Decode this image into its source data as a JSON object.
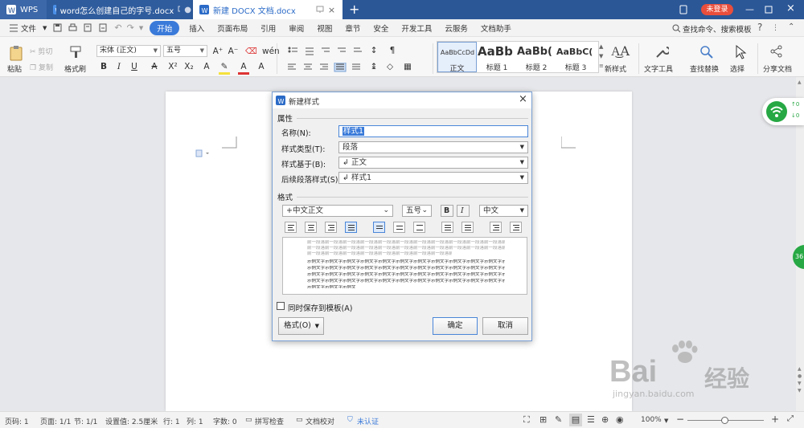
{
  "titlebar": {
    "app_label": "WPS",
    "tabs": [
      {
        "label": "word怎么创建自己的字号.docx"
      },
      {
        "label": "新建 DOCX 文档.docx"
      }
    ],
    "add_tab": "+",
    "login_label": "未登录"
  },
  "menubar": {
    "file_label": "文件",
    "items": [
      "开始",
      "插入",
      "页面布局",
      "引用",
      "审阅",
      "视图",
      "章节",
      "安全",
      "开发工具",
      "云服务",
      "文档助手"
    ],
    "search_label": "查找命令、搜索模板",
    "help": "?"
  },
  "ribbon": {
    "paste": "粘贴",
    "cut": "剪切",
    "copy": "复制",
    "format_painter": "格式刷",
    "font_name": "宋体 (正文)",
    "font_size": "五号",
    "bold": "B",
    "italic": "I",
    "underline": "U",
    "strike": "A",
    "superscript": "X²",
    "subscript": "X₂",
    "grow_font": "A⁺",
    "shrink_font": "A⁻",
    "styles": [
      {
        "preview": "AaBbCcDd",
        "name": "正文"
      },
      {
        "preview": "AaBb",
        "name": "标题 1"
      },
      {
        "preview": "AaBb(",
        "name": "标题 2"
      },
      {
        "preview": "AaBbC(",
        "name": "标题 3"
      }
    ],
    "new_style": "新样式",
    "text_tools": "文字工具",
    "find_replace": "查找替换",
    "select": "选择",
    "share": "分享文档"
  },
  "dialog": {
    "title": "新建样式",
    "props_section": "属性",
    "name_label": "名称(N):",
    "name_value": "样式1",
    "type_label": "样式类型(T):",
    "type_value": "段落",
    "based_label": "样式基于(B):",
    "based_value": "↲ 正文",
    "next_label": "后续段落样式(S):",
    "next_value": "↲ 样式1",
    "format_section": "格式",
    "font_value": "+中文正文",
    "size_value": "五号",
    "bold": "B",
    "italic": "I",
    "lang_value": "中文",
    "preview_prev_text": "前一段落前一段落前一段落前一段落前一段落前一段落前一段落前一段落前一段落前一段落前一段落前一段落前一段落前一段落",
    "preview_sample_text": "示例文字示例文字示例文字示例文字示例文字示例文字示例文字示例文字示例文字示例文字示例文字示例文字示例文字",
    "save_template_label": "同时保存到模板(A)",
    "format_button": "格式(O)",
    "ok_button": "确定",
    "cancel_button": "取消"
  },
  "statusbar": {
    "page_code": "页码: 1",
    "pages": "页面: 1/1",
    "section": "节: 1/1",
    "setting": "设置值: 2.5厘米",
    "row": "行: 1",
    "col": "列: 1",
    "words": "字数: 0",
    "spell_check": "拼写检查",
    "doc_proof": "文档校对",
    "unverified": "未认证",
    "zoom": "100%",
    "zoom_out": "−",
    "zoom_in": "+"
  },
  "side_widget": {
    "badge": "36"
  },
  "watermark": {
    "brand": "Bai",
    "brand2": "经验",
    "url": "jingyan.baidu.com"
  },
  "colors": {
    "titlebar": "#2b5797",
    "accent": "#3a7ad9",
    "login_badge": "#e94e3c",
    "wifi_green": "#27a844"
  }
}
